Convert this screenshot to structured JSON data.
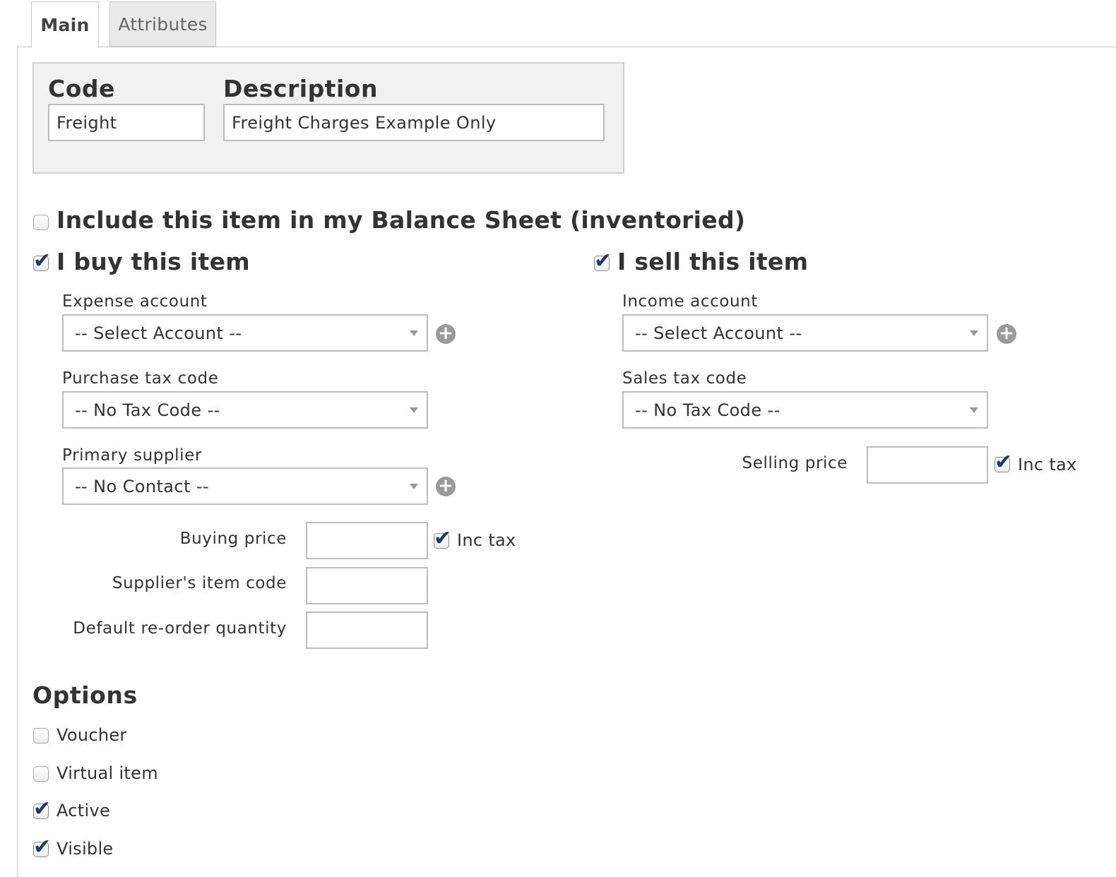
{
  "tabs": {
    "main": "Main",
    "attributes": "Attributes"
  },
  "header": {
    "code_label": "Code",
    "code_value": "Freight",
    "description_label": "Description",
    "description_value": "Freight Charges Example Only"
  },
  "inventoried": {
    "label": "Include this item in my Balance Sheet (inventoried)",
    "checked": false
  },
  "buy": {
    "heading": "I buy this item",
    "checked": true,
    "expense_account_label": "Expense account",
    "expense_account_value": "-- Select Account --",
    "purchase_tax_label": "Purchase tax code",
    "purchase_tax_value": "-- No Tax Code --",
    "primary_supplier_label": "Primary supplier",
    "primary_supplier_value": "-- No Contact --",
    "buying_price_label": "Buying price",
    "buying_price_value": "",
    "inc_tax_label": "Inc tax",
    "inc_tax_checked": true,
    "supplier_item_code_label": "Supplier's item code",
    "supplier_item_code_value": "",
    "reorder_qty_label": "Default re-order quantity",
    "reorder_qty_value": ""
  },
  "sell": {
    "heading": "I sell this item",
    "checked": true,
    "income_account_label": "Income account",
    "income_account_value": "-- Select Account --",
    "sales_tax_label": "Sales tax code",
    "sales_tax_value": "-- No Tax Code --",
    "selling_price_label": "Selling price",
    "selling_price_value": "",
    "inc_tax_label": "Inc tax",
    "inc_tax_checked": true
  },
  "options": {
    "heading": "Options",
    "voucher": {
      "label": "Voucher",
      "checked": false
    },
    "virtual_item": {
      "label": "Virtual item",
      "checked": false
    },
    "active": {
      "label": "Active",
      "checked": true
    },
    "visible": {
      "label": "Visible",
      "checked": true
    }
  },
  "icons": {
    "plus": "plus-circle-icon",
    "dropdown": "chevron-down-icon",
    "check": "checkmark-icon"
  }
}
